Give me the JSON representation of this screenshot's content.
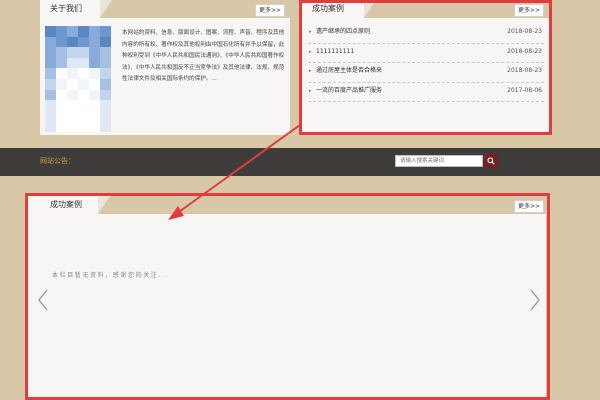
{
  "about": {
    "title": "关于我们",
    "more": "更多>>",
    "text": "本网站的资料、信息、版面设计、图案、流程、声音、程序及其他内容的所有权、著作权及其他权利由中国石化所有并予以保留，此种权利受到《中华人民共和国民法通则》、《中华人民共和国著作权法》、《中华人民共和国反不正当竞争法》及其他法律、法规、规范性法律文件及相关国际条约的保护。..."
  },
  "cases_top": {
    "title": "成功案例",
    "more": "更多>>",
    "items": [
      {
        "title": "遗产继承的四点原则",
        "date": "2018-08-23"
      },
      {
        "title": "1111111111",
        "date": "2018-08-23"
      },
      {
        "title": "通过房屋主体是否合格来",
        "date": "2018-08-23"
      },
      {
        "title": "一流的百度产品推广服务",
        "date": "2017-08-06"
      }
    ]
  },
  "notice": {
    "label": "网站公告："
  },
  "search": {
    "placeholder": "请输入搜索关键词"
  },
  "cases_bottom": {
    "title": "成功案例",
    "more": "更多>>",
    "empty_message": "本栏目暂无资料，感谢您的关注..."
  },
  "colors": {
    "background": "#d8c8a8",
    "notice_bar": "#3f3d3b",
    "notice_text": "#c9a03c",
    "annotation_red": "#e23c3c",
    "search_button": "#7a1f24"
  }
}
